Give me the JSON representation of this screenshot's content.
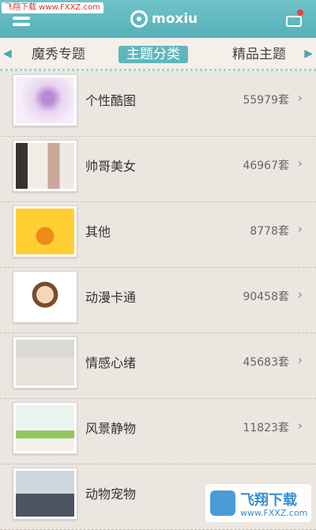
{
  "header": {
    "watermark_text": "飞翔下载 www.FXXZ.com",
    "app_name": "moxiu",
    "colors": {
      "bar": "#5fb7bd",
      "accent": "#4fa6ad",
      "badge": "#e8433a"
    }
  },
  "tabs": [
    {
      "label": "魔秀专题",
      "selected": false
    },
    {
      "label": "主题分类",
      "selected": true
    },
    {
      "label": "精品主题",
      "selected": false
    }
  ],
  "categories": [
    {
      "name": "个性酷图",
      "count": "55979套",
      "thumb": "purple"
    },
    {
      "name": "帅哥美女",
      "count": "46967套",
      "thumb": "girl"
    },
    {
      "name": "其他",
      "count": "8778套",
      "thumb": "pumpkin"
    },
    {
      "name": "动漫卡通",
      "count": "90458套",
      "thumb": "cartoon"
    },
    {
      "name": "情感心绪",
      "count": "45683套",
      "thumb": "hand"
    },
    {
      "name": "风景静物",
      "count": "11823套",
      "thumb": "scenery"
    },
    {
      "name": "动物宠物",
      "count": "",
      "thumb": "cat"
    }
  ],
  "footer_watermark": {
    "title": "飞翔下载",
    "url": "www.FXXZ.com"
  }
}
